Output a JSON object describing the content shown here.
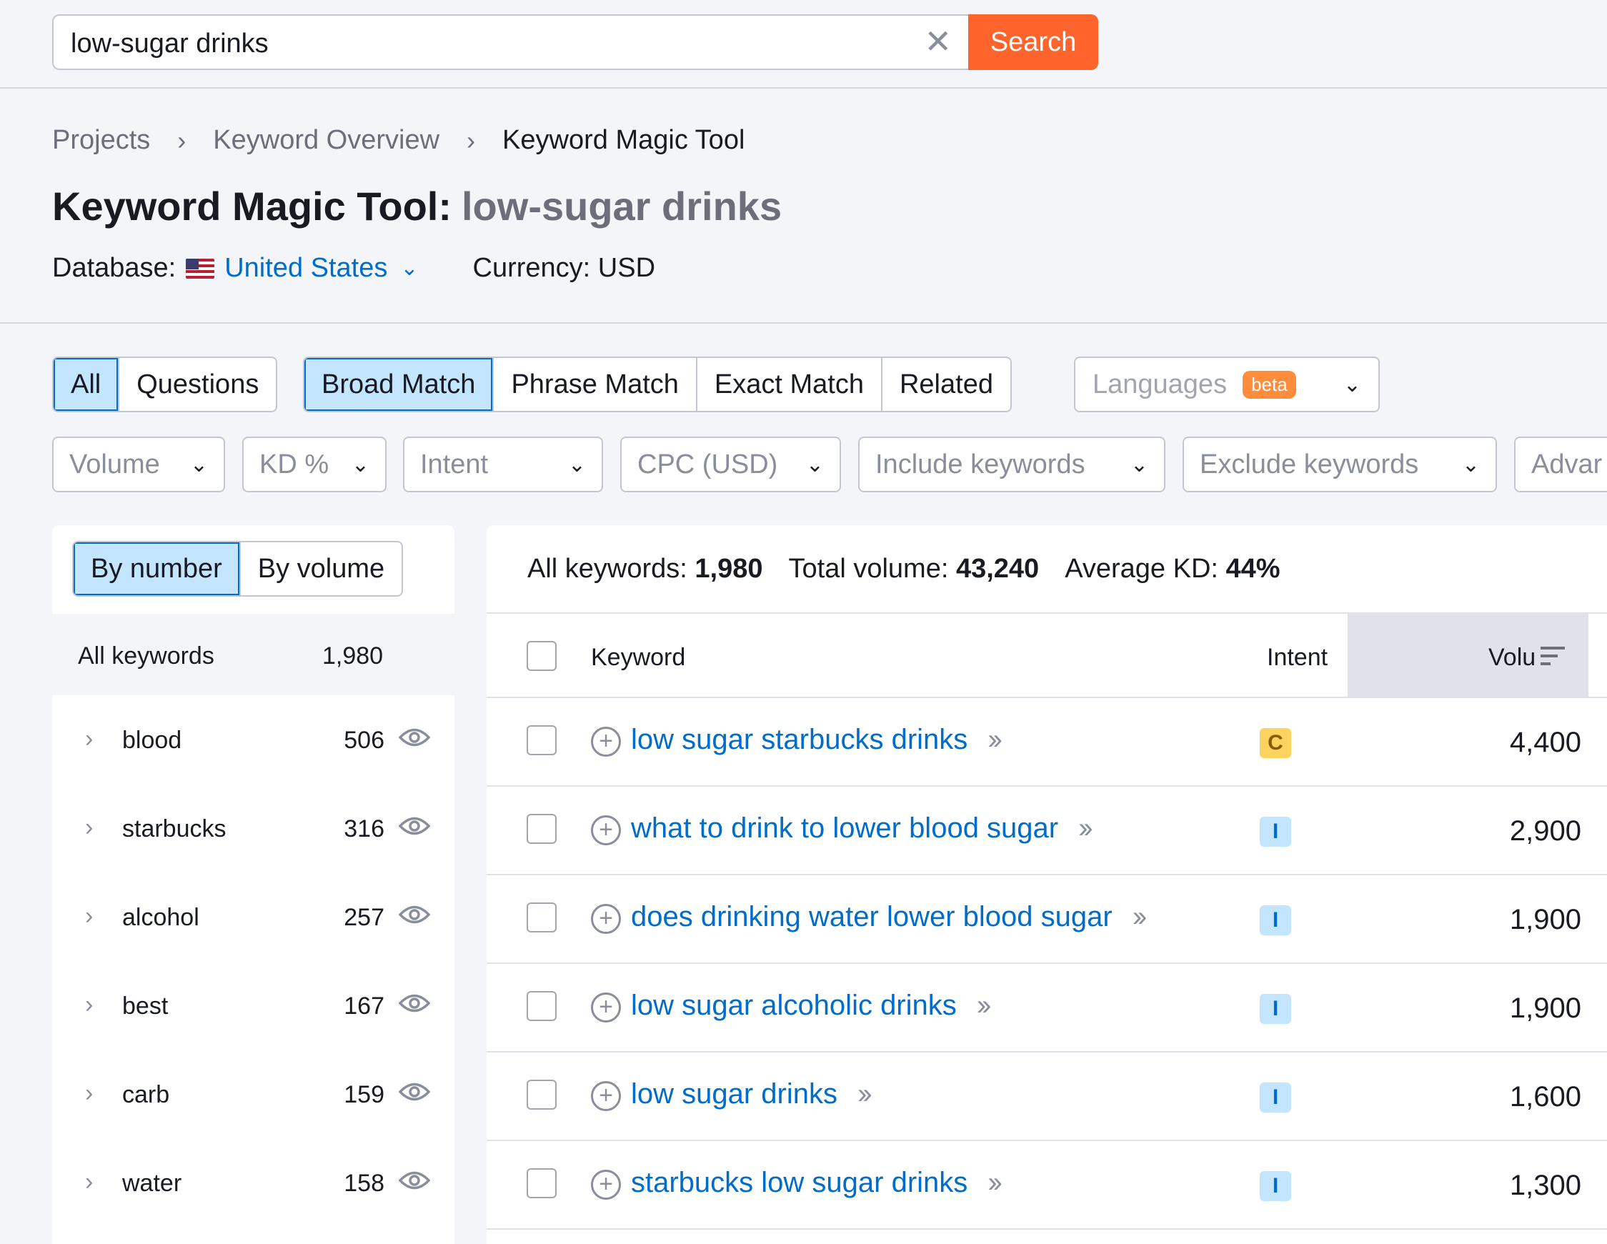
{
  "search": {
    "value": "low-sugar drinks",
    "button": "Search",
    "clear": "✕"
  },
  "breadcrumb": [
    "Projects",
    "Keyword Overview",
    "Keyword Magic Tool"
  ],
  "title": {
    "label": "Keyword Magic Tool:",
    "keyword": "low-sugar drinks"
  },
  "database": {
    "label": "Database:",
    "value": "United States",
    "currency": "Currency: USD"
  },
  "tabs_type": [
    {
      "label": "All",
      "active": true
    },
    {
      "label": "Questions",
      "active": false
    }
  ],
  "tabs_match": [
    {
      "label": "Broad Match",
      "active": true
    },
    {
      "label": "Phrase Match",
      "active": false
    },
    {
      "label": "Exact Match",
      "active": false
    },
    {
      "label": "Related",
      "active": false
    }
  ],
  "languages": {
    "label": "Languages",
    "badge": "beta"
  },
  "filters": [
    "Volume",
    "KD %",
    "Intent",
    "CPC (USD)",
    "Include keywords",
    "Exclude keywords",
    "Advar"
  ],
  "sidebar": {
    "toggle": [
      {
        "label": "By number",
        "active": true
      },
      {
        "label": "By volume",
        "active": false
      }
    ],
    "all": {
      "label": "All keywords",
      "count": "1,980"
    },
    "groups": [
      {
        "name": "blood",
        "count": "506"
      },
      {
        "name": "starbucks",
        "count": "316"
      },
      {
        "name": "alcohol",
        "count": "257"
      },
      {
        "name": "best",
        "count": "167"
      },
      {
        "name": "carb",
        "count": "159"
      },
      {
        "name": "water",
        "count": "158"
      }
    ]
  },
  "summary": {
    "all_label": "All keywords:",
    "all_value": "1,980",
    "vol_label": "Total volume:",
    "vol_value": "43,240",
    "kd_label": "Average KD:",
    "kd_value": "44%"
  },
  "table": {
    "headers": {
      "keyword": "Keyword",
      "intent": "Intent",
      "volume": "Volu"
    },
    "rows": [
      {
        "keyword": "low sugar starbucks drinks",
        "intent": "C",
        "volume": "4,400"
      },
      {
        "keyword": "what to drink to lower blood sugar",
        "intent": "I",
        "volume": "2,900"
      },
      {
        "keyword": "does drinking water lower blood sugar",
        "intent": "I",
        "volume": "1,900"
      },
      {
        "keyword": "low sugar alcoholic drinks",
        "intent": "I",
        "volume": "1,900"
      },
      {
        "keyword": "low sugar drinks",
        "intent": "I",
        "volume": "1,600"
      },
      {
        "keyword": "starbucks low sugar drinks",
        "intent": "I",
        "volume": "1,300"
      }
    ]
  },
  "colors": {
    "accent": "#ff642d",
    "link": "#006dca",
    "active_bg": "#c4e5fe",
    "commercial": "#fcd35f"
  }
}
